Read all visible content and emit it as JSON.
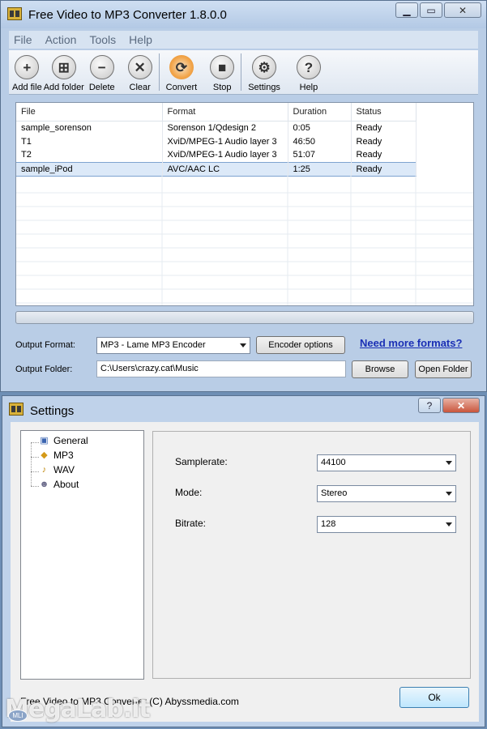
{
  "main_window": {
    "title": "Free Video to MP3 Converter 1.8.0.0",
    "menu": [
      "File",
      "Action",
      "Tools",
      "Help"
    ],
    "toolbar": [
      {
        "label": "Add file",
        "icon": "plus-icon",
        "glyph": "+"
      },
      {
        "label": "Add folder",
        "icon": "add-folder-icon",
        "glyph": "⊞"
      },
      {
        "label": "Delete",
        "icon": "minus-icon",
        "glyph": "−"
      },
      {
        "label": "Clear",
        "icon": "x-icon",
        "glyph": "✕"
      },
      {
        "label": "Convert",
        "icon": "convert-icon",
        "glyph": "⟳"
      },
      {
        "label": "Stop",
        "icon": "stop-icon",
        "glyph": "■"
      },
      {
        "label": "Settings",
        "icon": "gear-icon",
        "glyph": "⚙"
      },
      {
        "label": "Help",
        "icon": "question-icon",
        "glyph": "?"
      }
    ],
    "table": {
      "columns": [
        "File",
        "Format",
        "Duration",
        "Status"
      ],
      "rows": [
        {
          "file": "sample_sorenson",
          "format": "Sorenson 1/Qdesign 2",
          "duration": "0:05",
          "status": "Ready"
        },
        {
          "file": "T1",
          "format": "XviD/MPEG-1 Audio layer 3",
          "duration": "46:50",
          "status": "Ready"
        },
        {
          "file": "T2",
          "format": "XviD/MPEG-1 Audio layer 3",
          "duration": "51:07",
          "status": "Ready"
        },
        {
          "file": "sample_iPod",
          "format": "AVC/AAC LC",
          "duration": "1:25",
          "status": "Ready",
          "selected": true
        }
      ]
    },
    "output_format_label": "Output Format:",
    "output_format_value": "MP3 - Lame MP3 Encoder",
    "encoder_options_label": "Encoder options",
    "more_formats_link": "Need more formats?",
    "output_folder_label": "Output Folder:",
    "output_folder_value": "C:\\Users\\crazy.cat\\Music",
    "browse_label": "Browse",
    "open_folder_label": "Open Folder"
  },
  "settings_window": {
    "title": "Settings",
    "tree": [
      {
        "label": "General",
        "icon": "general-icon"
      },
      {
        "label": "MP3",
        "icon": "mp3-icon"
      },
      {
        "label": "WAV",
        "icon": "wav-icon"
      },
      {
        "label": "About",
        "icon": "about-icon"
      }
    ],
    "fields": [
      {
        "label": "Samplerate:",
        "value": "44100"
      },
      {
        "label": "Mode:",
        "value": "Stereo"
      },
      {
        "label": "Bitrate:",
        "value": "128"
      }
    ],
    "footer": "Free Video to MP3 Converter (C) Abyssmedia.com",
    "ok_label": "Ok"
  },
  "watermark": {
    "text": "MegaLab.it",
    "badge": "MLI"
  },
  "colors": {
    "titlebar": "#b9cde6",
    "link": "#1a2fb5",
    "selection": "#dce9f8",
    "close_button": "#c9553c"
  }
}
